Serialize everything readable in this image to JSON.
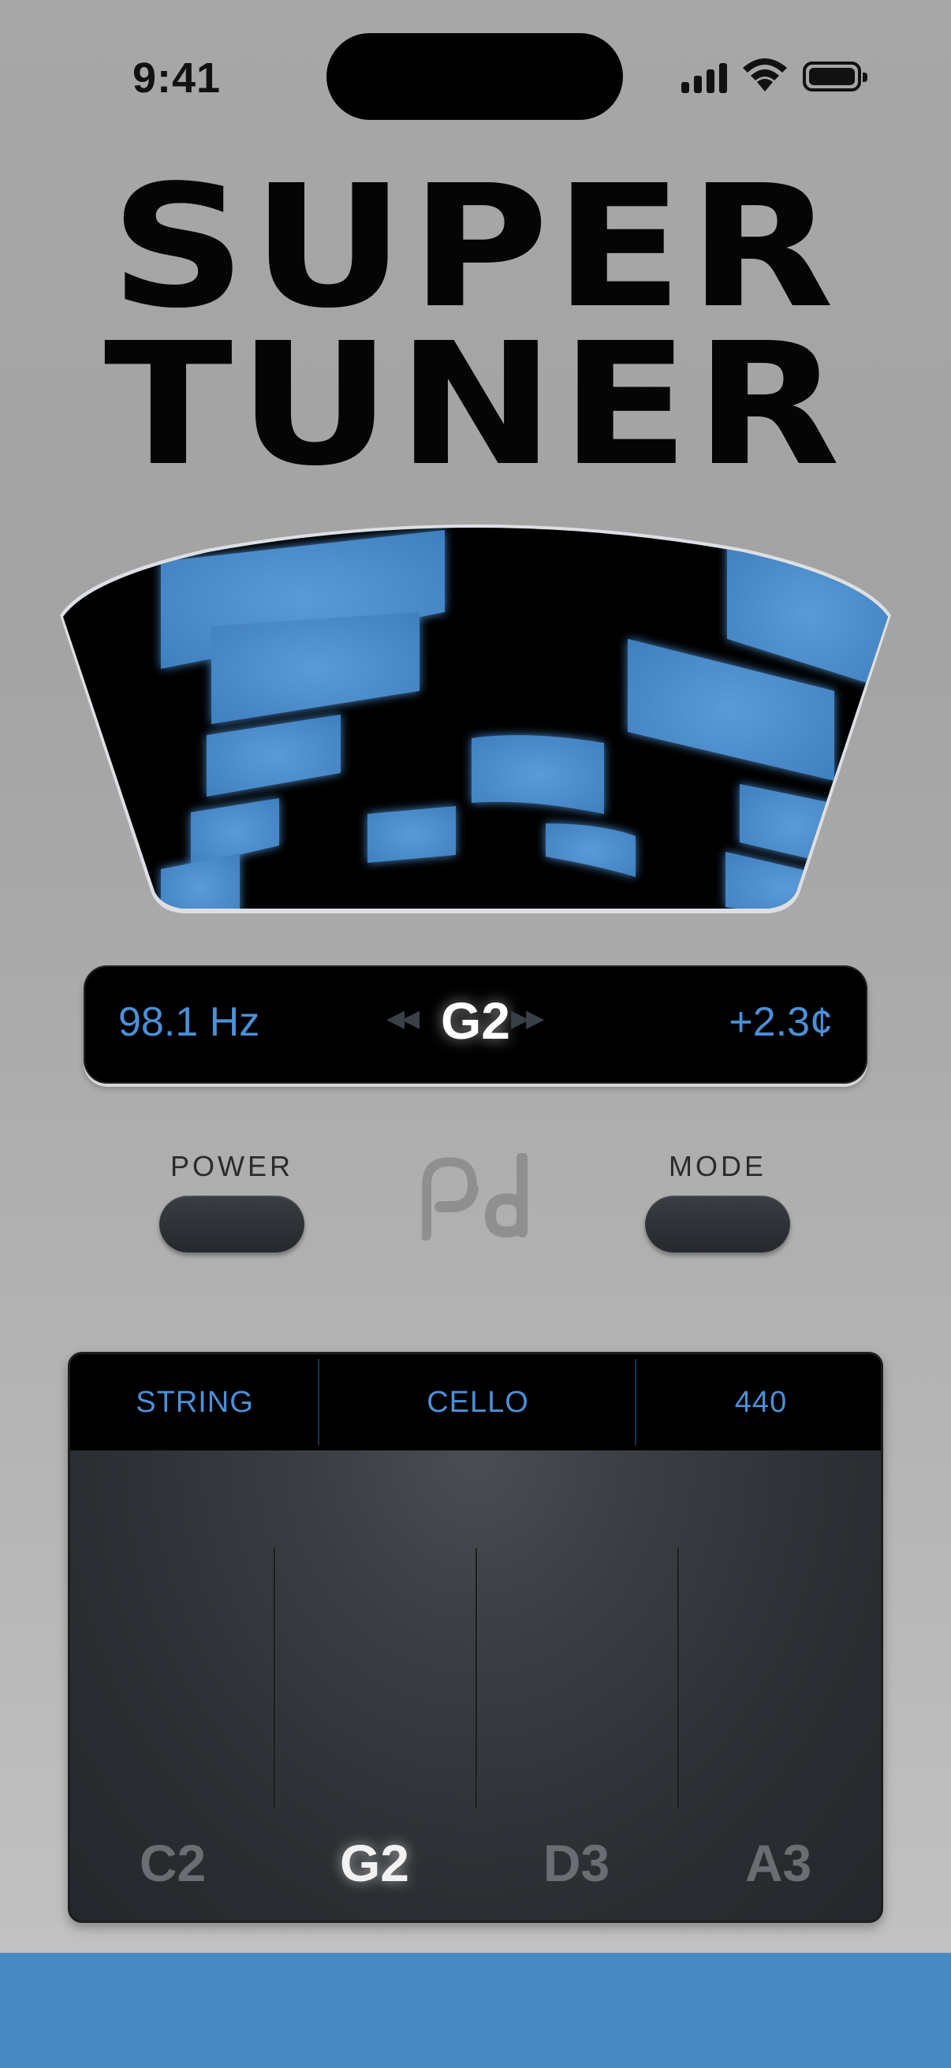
{
  "status_bar": {
    "time": "9:41"
  },
  "app": {
    "title_line1": "SUPER",
    "title_line2": "TUNER"
  },
  "readout": {
    "frequency": "98.1 Hz",
    "note": "G2",
    "cents": "+2.3¢",
    "arrows_left": "◀◀",
    "arrows_right": "▶▶"
  },
  "controls": {
    "power_label": "POWER",
    "mode_label": "MODE"
  },
  "panel": {
    "header": {
      "left": "STRING",
      "center": "CELLO",
      "right": "440"
    },
    "strings": [
      "C2",
      "G2",
      "D3",
      "A3"
    ],
    "active_string": "G2"
  },
  "colors": {
    "accent_blue": "#4a90d8",
    "meter_block": "#4a88c8",
    "bottom_bar": "#4a8ac2"
  }
}
